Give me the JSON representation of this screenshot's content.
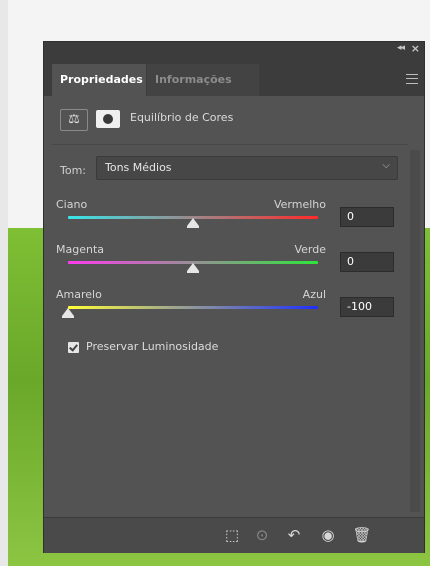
{
  "panel": {
    "tabs": [
      {
        "label": "Propriedades",
        "active": true
      },
      {
        "label": "Informações",
        "active": false
      }
    ],
    "topbar": {
      "collapse_icon": "double-chevron-left",
      "close_icon": "close"
    },
    "menu_icon": "hamburger"
  },
  "header": {
    "icon": "balance-scale",
    "mask_icon": "layer-mask",
    "title": "Equilíbrio de Cores"
  },
  "tone": {
    "label": "Tom:",
    "selected": "Tons Médios"
  },
  "sliders": [
    {
      "left_label": "Ciano",
      "right_label": "Vermelho",
      "value": "0",
      "min": -100,
      "max": 100,
      "numeric": 0,
      "gradient": [
        "#39e6ea",
        "#ff2a2a"
      ]
    },
    {
      "left_label": "Magenta",
      "right_label": "Verde",
      "value": "0",
      "min": -100,
      "max": 100,
      "numeric": 0,
      "gradient": [
        "#ff3bf0",
        "#2ee63a"
      ]
    },
    {
      "left_label": "Amarelo",
      "right_label": "Azul",
      "value": "-100",
      "min": -100,
      "max": 100,
      "numeric": -100,
      "gradient": [
        "#ffff38",
        "#1f2fff"
      ]
    }
  ],
  "preserve": {
    "label": "Preservar Luminosidade",
    "checked": true
  },
  "bottom_icons": [
    "clip-to-layer",
    "view-previous",
    "reset",
    "visibility",
    "delete"
  ]
}
